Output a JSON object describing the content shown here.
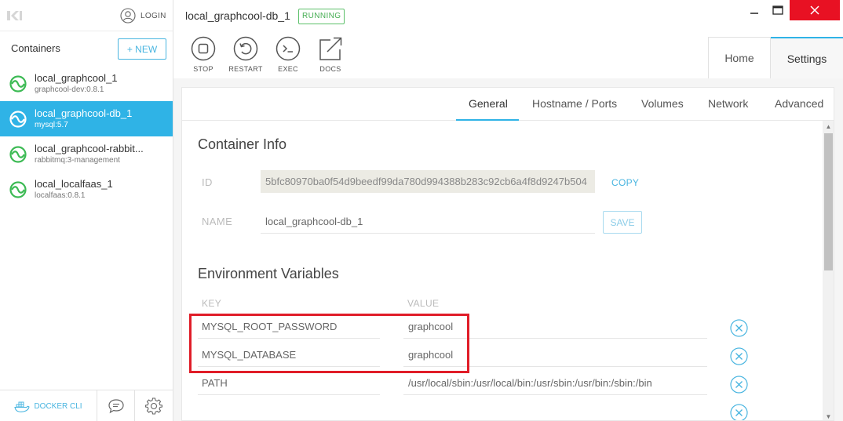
{
  "sidebar": {
    "login_label": "LOGIN",
    "containers_title": "Containers",
    "new_button": "+ NEW",
    "containers": [
      {
        "name": "local_graphcool_1",
        "image": "graphcool-dev:0.8.1",
        "active": false
      },
      {
        "name": "local_graphcool-db_1",
        "image": "mysql:5.7",
        "active": true
      },
      {
        "name": "local_graphcool-rabbit...",
        "image": "rabbitmq:3-management",
        "active": false
      },
      {
        "name": "local_localfaas_1",
        "image": "localfaas:0.8.1",
        "active": false
      }
    ],
    "footer": {
      "docker_cli_label": "DOCKER CLI"
    }
  },
  "header": {
    "container_name": "local_graphcool-db_1",
    "status": "RUNNING",
    "actions": [
      {
        "label": "STOP",
        "icon": "stop-icon"
      },
      {
        "label": "RESTART",
        "icon": "restart-icon"
      },
      {
        "label": "EXEC",
        "icon": "terminal-icon"
      },
      {
        "label": "DOCS",
        "icon": "external-link-icon"
      }
    ],
    "tabs": {
      "home": "Home",
      "settings": "Settings"
    }
  },
  "settings": {
    "subtabs": [
      "General",
      "Hostname / Ports",
      "Volumes",
      "Network",
      "Advanced"
    ],
    "active_subtab": "General",
    "container_info": {
      "title": "Container Info",
      "id_label": "ID",
      "id_value": "5bfc80970ba0f54d9beedf99da780d994388b283c92cb6a4f8d9247b504",
      "copy_label": "COPY",
      "name_label": "NAME",
      "name_value": "local_graphcool-db_1",
      "save_label": "SAVE"
    },
    "env": {
      "title": "Environment Variables",
      "key_header": "KEY",
      "value_header": "VALUE",
      "rows": [
        {
          "key": "MYSQL_ROOT_PASSWORD",
          "value": "graphcool"
        },
        {
          "key": "MYSQL_DATABASE",
          "value": "graphcool"
        },
        {
          "key": "PATH",
          "value": "/usr/local/sbin:/usr/local/bin:/usr/sbin:/usr/bin:/sbin:/bin"
        }
      ]
    }
  },
  "colors": {
    "accent": "#2fb3e6",
    "running": "#45ad52",
    "highlight": "#e01d28",
    "close": "#e81123"
  }
}
